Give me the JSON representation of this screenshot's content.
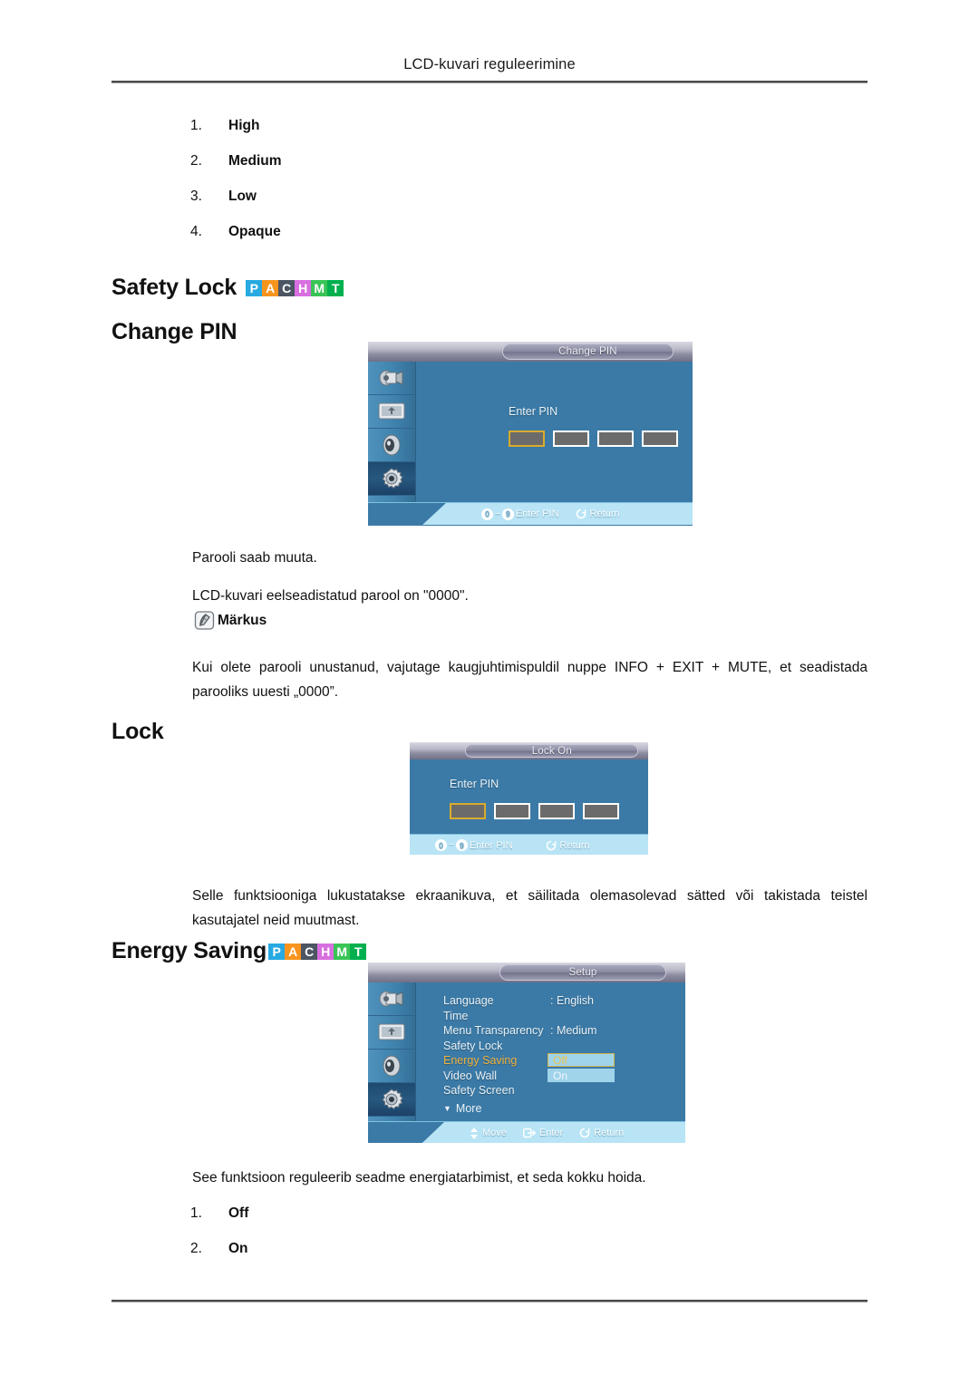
{
  "page": {
    "header": "LCD-kuvari reguleerimine"
  },
  "transparency_list": {
    "items": [
      {
        "num": "1.",
        "label": "High"
      },
      {
        "num": "2.",
        "label": "Medium"
      },
      {
        "num": "3.",
        "label": "Low"
      },
      {
        "num": "4.",
        "label": "Opaque"
      }
    ]
  },
  "badges": {
    "items": [
      {
        "letter": "P",
        "color": "#27a9e1"
      },
      {
        "letter": "A",
        "color": "#f7941e"
      },
      {
        "letter": "C",
        "color": "#4b5563"
      },
      {
        "letter": "H",
        "color": "#d86fe0"
      },
      {
        "letter": "M",
        "color": "#39c456"
      },
      {
        "letter": "T",
        "color": "#00b04f"
      }
    ]
  },
  "sections": {
    "safety_lock": {
      "title": "Safety Lock",
      "subtitle": "Change PIN",
      "osd": {
        "title": "Change PIN",
        "pin_label": "Enter PIN",
        "pin_digits": 4,
        "footer": {
          "key_from": "0",
          "key_to": "9",
          "enter_pin": "Enter PIN",
          "return": "Return"
        }
      },
      "paragraph_1": "Parooli saab muuta.",
      "paragraph_2": "LCD-kuvari eelseadistatud parool on \"0000\".",
      "note_label": "Märkus",
      "note_text": "Kui olete parooli unustanud, vajutage kaugjuhtimispuldil nuppe INFO + EXIT + MUTE, et seadistada parooliks uuesti „0000”."
    },
    "lock": {
      "title": "Lock",
      "osd": {
        "title": "Lock On",
        "pin_label": "Enter PIN",
        "pin_digits": 4,
        "footer": {
          "key_from": "0",
          "key_to": "9",
          "enter_pin": "Enter PIN",
          "return": "Return"
        }
      },
      "paragraph": "Selle funktsiooniga lukustatakse ekraanikuva, et säilitada olemasolevad sätted või takistada teistel kasutajatel neid muutmast."
    },
    "energy_saving": {
      "title": "Energy Saving",
      "osd": {
        "title": "Setup",
        "rows": [
          {
            "label": "Language",
            "value": ": English",
            "highlight": false
          },
          {
            "label": "Time",
            "value": "",
            "highlight": false
          },
          {
            "label": "Menu Transparency",
            "value": ": Medium",
            "highlight": false
          },
          {
            "label": "Safety Lock",
            "value": "",
            "highlight": false
          },
          {
            "label": "Energy Saving",
            "value": ":",
            "highlight": true
          },
          {
            "label": "Video Wall",
            "value": "",
            "highlight": false
          },
          {
            "label": "Safety Screen",
            "value": "",
            "highlight": false
          }
        ],
        "more": "More",
        "option_off": "Off",
        "option_on": "On",
        "footer": {
          "move": "Move",
          "enter": "Enter",
          "return": "Return"
        }
      },
      "paragraph": "See funktsioon reguleerib seadme energiatarbimist, et seda kokku hoida.",
      "options": [
        {
          "num": "1.",
          "label": "Off"
        },
        {
          "num": "2.",
          "label": "On"
        }
      ]
    }
  }
}
